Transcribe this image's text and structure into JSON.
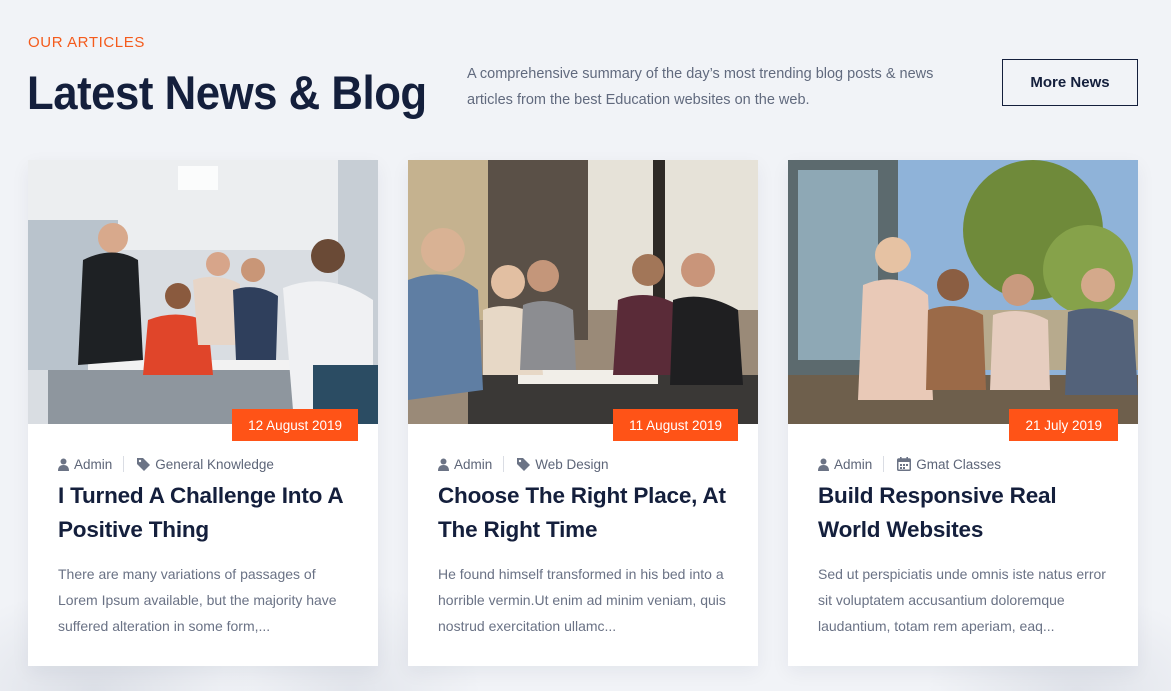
{
  "header": {
    "eyebrow": "OUR ARTICLES",
    "title": "Latest News & Blog",
    "summary": "A comprehensive summary of the day’s most trending blog posts & news articles from the best Education websites on the web.",
    "more_button": "More News"
  },
  "colors": {
    "accent": "#ff5317",
    "heading": "#141f3c",
    "text": "#6a7285",
    "background": "#f1f3f7"
  },
  "cards": [
    {
      "date": "12 August 2019",
      "author": "Admin",
      "category": "General Knowledge",
      "category_icon": "tag-icon",
      "title": "I Turned A Challenge Into A Positive Thing",
      "excerpt": "There are many variations of passages of Lorem Ipsum available, but the majority have suffered alteration in some form,..."
    },
    {
      "date": "11 August 2019",
      "author": "Admin",
      "category": "Web Design",
      "category_icon": "tag-icon",
      "title": "Choose The Right Place, At The Right Time",
      "excerpt": "He found himself transformed in his bed into a horrible vermin.Ut enim ad minim veniam, quis nostrud exercitation ullamc..."
    },
    {
      "date": "21 July 2019",
      "author": "Admin",
      "category": "Gmat Classes",
      "category_icon": "calendar-icon",
      "title": "Build Responsive Real World Websites",
      "excerpt": "Sed ut perspiciatis unde omnis iste natus error sit voluptatem accusantium doloremque laudantium, totam rem aperiam, eaq..."
    }
  ]
}
